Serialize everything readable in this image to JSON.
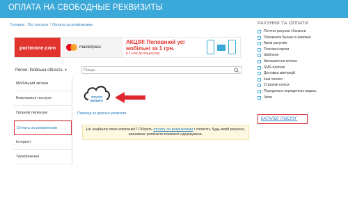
{
  "header": {
    "title": "ОПЛАТА НА СВОБОДНЫЕ РЕКВИЗИТЫ"
  },
  "breadcrumb": [
    "Головна",
    "Всі послуги",
    "Оплата за реквізитами"
  ],
  "banner": {
    "brand": "portmone.com",
    "partner": "mastercard",
    "partner_suffix": "masterpass",
    "promo_title": "АКЦІЯ! Поповнюй усі мобільні за 1 грн.",
    "promo_text": "в 1 клік до кінця року"
  },
  "region": {
    "label": "Регіон: Київська область",
    "arrow": "▼"
  },
  "search": {
    "placeholder": "Пошук",
    "value": ""
  },
  "categories": [
    {
      "label": "Мобільний зв'язок"
    },
    {
      "label": "Комунальні послуги"
    },
    {
      "label": "Грошові перекази"
    },
    {
      "label": "Оплата за реквізитами"
    },
    {
      "label": "Інтернет"
    },
    {
      "label": "Телебачення"
    }
  ],
  "content": {
    "logo_text": "ПЛАТИ ВІЛЬНО",
    "link": "Перевод на довільні реквізити",
    "notice_pre": "Не знайшли свою компанію? Оберіть",
    "notice_link": "оплату за реквізитами",
    "notice_post": "і сплатіть будь-який рахунок, вказавши реквізити компанії-одержувача."
  },
  "right": {
    "title": "РАХУНКИ ТА ОПЛАТИ",
    "items": [
      "Поточні рахунки і баланси",
      "Поповнити баланс в компанії",
      "Архів рахунків",
      "Платіжні картки",
      "Шаблони",
      "Автоматична оплата",
      "SMS-платежі",
      "Доставка квитанцій",
      "Інші оплати",
      "Страхові поліси",
      "Передплата періодичних видань",
      "Звіти"
    ],
    "catalog": "КАТАЛОГ ПОСЛУГ"
  },
  "colors": {
    "header": "#3aa8d8",
    "accent_red": "#d8262e",
    "link": "#2a7fc0"
  }
}
